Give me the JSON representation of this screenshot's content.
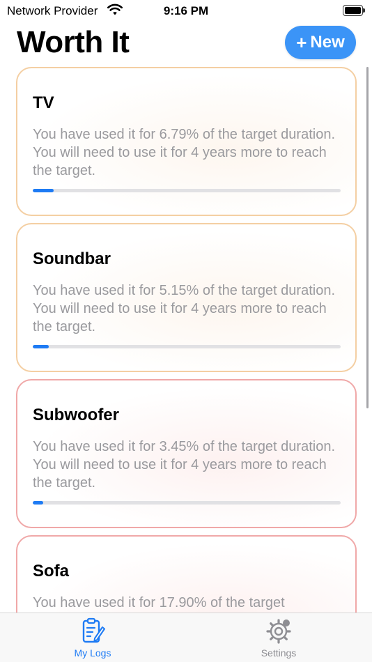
{
  "status_bar": {
    "carrier": "Network Provider",
    "time": "9:16 PM"
  },
  "header": {
    "title": "Worth It",
    "new_button": {
      "icon": "plus-icon",
      "label": "New"
    }
  },
  "items": [
    {
      "name": "TV",
      "description": "You have used it for 6.79% of the target duration. You will need to use it for 4 years more to reach the target.",
      "progress_percent": 6.79,
      "border_color": "#f4cfa3"
    },
    {
      "name": "Soundbar",
      "description": "You have used it for 5.15% of the target duration. You will need to use it for 4 years more to reach the target.",
      "progress_percent": 5.15,
      "border_color": "#f4cfa3"
    },
    {
      "name": "Subwoofer",
      "description": "You have used it for 3.45% of the target duration. You will need to use it for 4 years more to reach the target.",
      "progress_percent": 3.45,
      "border_color": "#f0a8a8"
    },
    {
      "name": "Sofa",
      "description": "You have used it for 17.90% of the target",
      "progress_percent": 17.9,
      "border_color": "#f0a8a8"
    }
  ],
  "tab_bar": {
    "tabs": [
      {
        "label": "My Logs",
        "icon": "clipboard-edit-icon",
        "active": true
      },
      {
        "label": "Settings",
        "icon": "gear-icon",
        "active": false
      }
    ]
  },
  "colors": {
    "accent": "#1e7bf4",
    "button": "#3b94f7",
    "description_text": "#9a9a9e",
    "progress_track": "#e1e1e4"
  }
}
